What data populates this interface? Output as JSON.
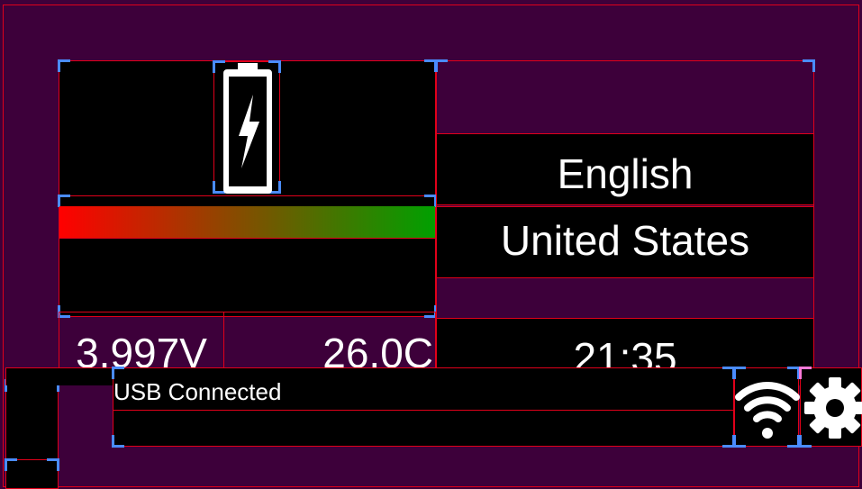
{
  "colors": {
    "background": "#3d003a",
    "panel": "#000000",
    "outline": "#e0001a",
    "handle": "#4a8cff",
    "battery_gradient_start": "#ff0000",
    "battery_gradient_end": "#00a000"
  },
  "battery": {
    "icon": "battery-charging-icon",
    "level_fraction": 1.0,
    "voltage": "3.997V",
    "temperature": "26.0C"
  },
  "locale": {
    "language": "English",
    "region": "United States"
  },
  "clock": {
    "time": "21:35"
  },
  "status": {
    "usb": "USB Connected"
  },
  "icons": {
    "wifi": "wifi-icon",
    "settings": "gear-icon"
  }
}
